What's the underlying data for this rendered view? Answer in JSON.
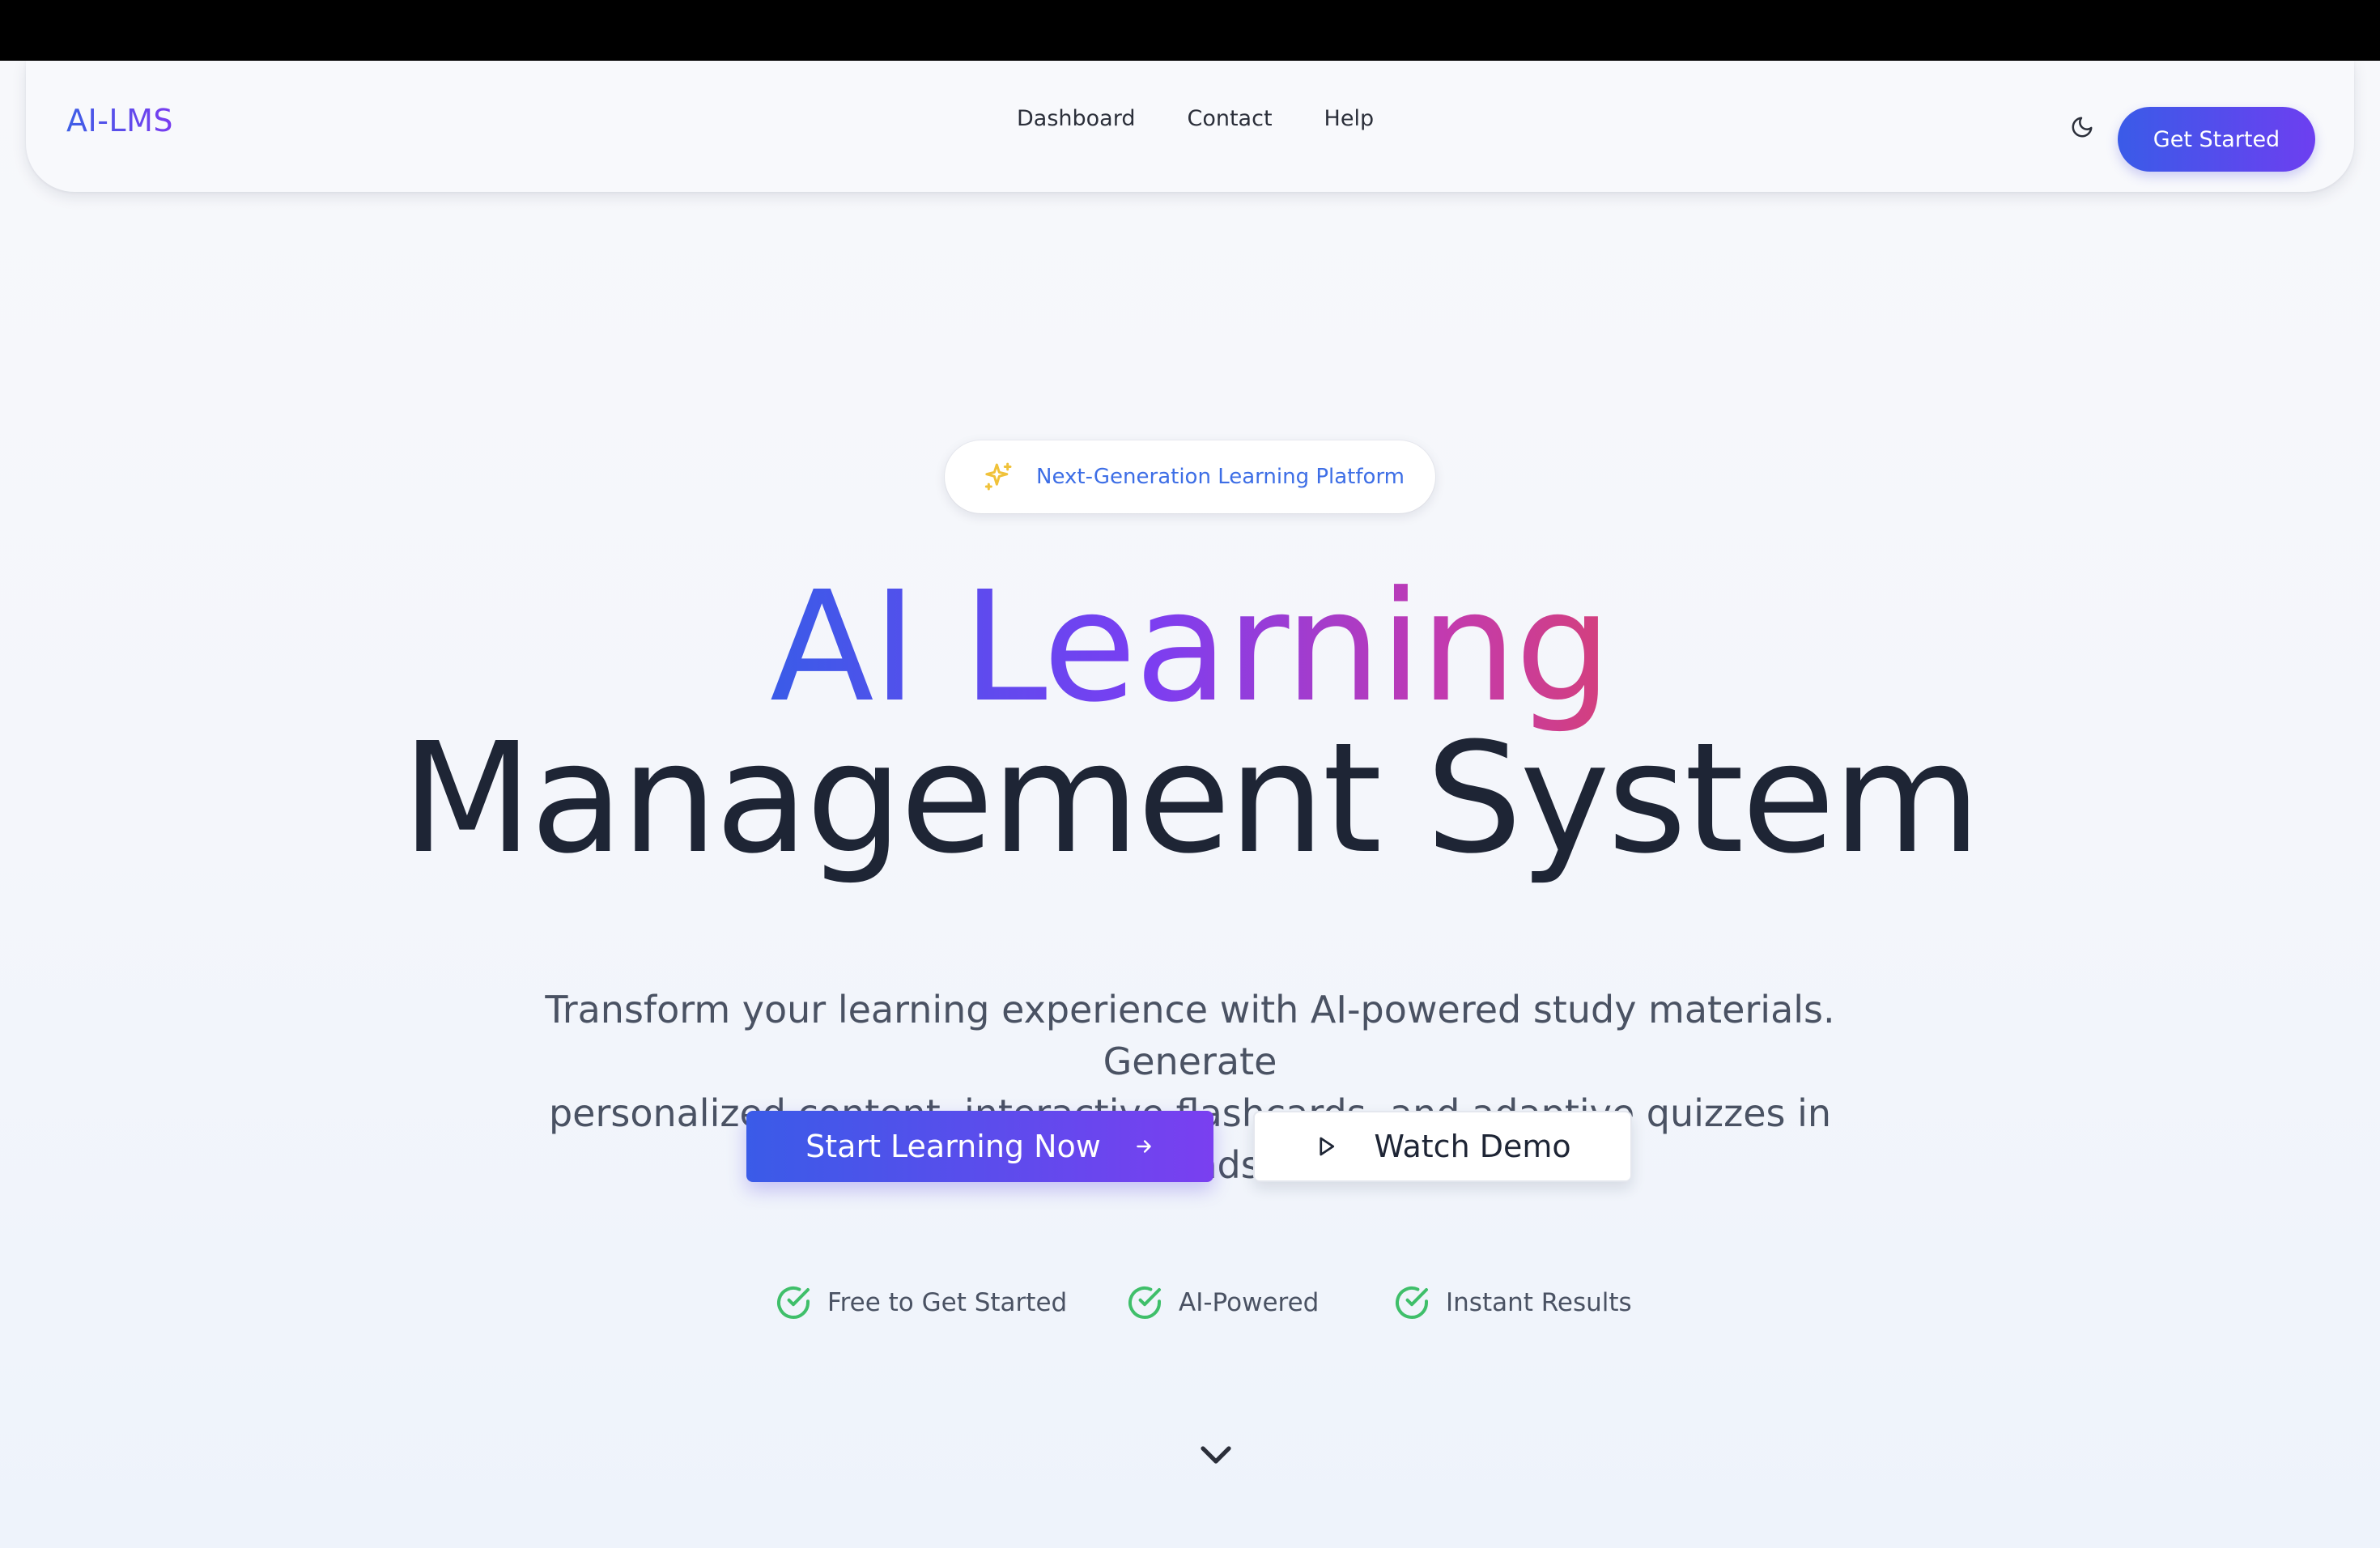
{
  "navbar": {
    "logo": "AI-LMS",
    "links": [
      "Dashboard",
      "Contact",
      "Help"
    ],
    "theme_toggle_icon": "moon-icon",
    "cta_label": "Get Started"
  },
  "hero": {
    "badge_icon": "sparkles-icon",
    "badge_text": "Next-Generation Learning Platform",
    "headline_gradient": "AI Learning",
    "headline_plain": "Management System",
    "subtitle_line1": "Transform your learning experience with AI-powered study materials. Generate",
    "subtitle_line2": "personalized content, interactive flashcards, and adaptive quizzes in seconds.",
    "primary_cta": "Start Learning Now",
    "primary_cta_icon": "arrow-right-icon",
    "secondary_cta": "Watch Demo",
    "secondary_cta_icon": "play-icon",
    "features": [
      "Free to Get Started",
      "AI-Powered",
      "Instant Results"
    ],
    "feature_icon": "check-circle-icon",
    "scroll_icon": "chevron-down-icon"
  },
  "colors": {
    "accent_blue": "#3a5be8",
    "accent_purple": "#7a3ff0",
    "accent_pink": "#d4407c",
    "check_green": "#3fbf6a",
    "sparkle_yellow": "#f0c23a",
    "text_dark": "#1e2535"
  }
}
